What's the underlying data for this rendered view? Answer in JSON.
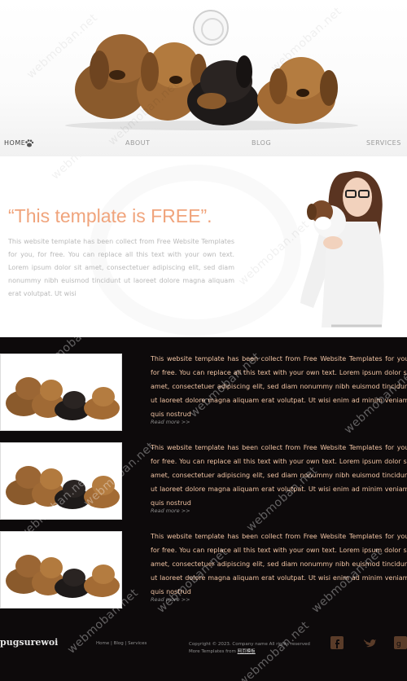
{
  "nav": {
    "items": [
      {
        "label": "HOME",
        "active": true
      },
      {
        "label": "ABOUT",
        "active": false
      },
      {
        "label": "BLOG",
        "active": false
      },
      {
        "label": "SERVICES",
        "active": false
      }
    ]
  },
  "intro": {
    "title": "“This template is FREE”.",
    "text": "This website template has been collect from Free Website Templates for you, for free. You can replace all this text with your own text. Lorem ipsum dolor sit amet, consectetuer adipiscing elit, sed diam nonummy nibh euismod tincidunt ut laoreet dolore magna aliquam erat volutpat. Ut wisi"
  },
  "items": [
    {
      "text": "This website template has been collect from Free Website Templates for you, for free. You can replace all this text with your own text. Lorem ipsum dolor sit amet, consectetuer adipiscing elit, sed diam nonummy nibh euismod tincidunt ut laoreet dolore magna aliquam erat volutpat. Ut wisi enim ad minim veniam, quis nostrud",
      "read_more": "Read more >>"
    },
    {
      "text": "This website template has been collect from Free Website Templates for you, for free. You can replace all this text with your own text. Lorem ipsum dolor sit amet, consectetuer adipiscing elit, sed diam nonummy nibh euismod tincidunt ut laoreet dolore magna aliquam erat volutpat. Ut wisi enim ad minim veniam, quis nostrud",
      "read_more": "Read more >>"
    },
    {
      "text": "This website template has been collect from Free Website Templates for you, for free. You can replace all this text with your own text. Lorem ipsum dolor sit amet, consectetuer adipiscing elit, sed diam nonummy nibh euismod tincidunt ut laoreet dolore magna aliquam erat volutpat. Ut wisi enim ad minim veniam, quis nostrud",
      "read_more": "Read more >>"
    }
  ],
  "footer": {
    "brand": "pugsurewoi",
    "links": [
      "Home",
      "Blog",
      "Services"
    ],
    "copyright_line1": "Copyright © 2023. Company name All rights reserved",
    "copyright_line2_prefix": "More Templates from",
    "copyright_link": "网页模板"
  },
  "watermark": "webmoban.net",
  "icons": {
    "nav_paw": "paw-icon",
    "social": [
      "facebook-icon",
      "twitter-icon",
      "googleplus-icon"
    ]
  },
  "colors": {
    "accent": "#f0a47c",
    "item_text": "#f1c4a4",
    "dark_bg": "#0d0a0b"
  }
}
